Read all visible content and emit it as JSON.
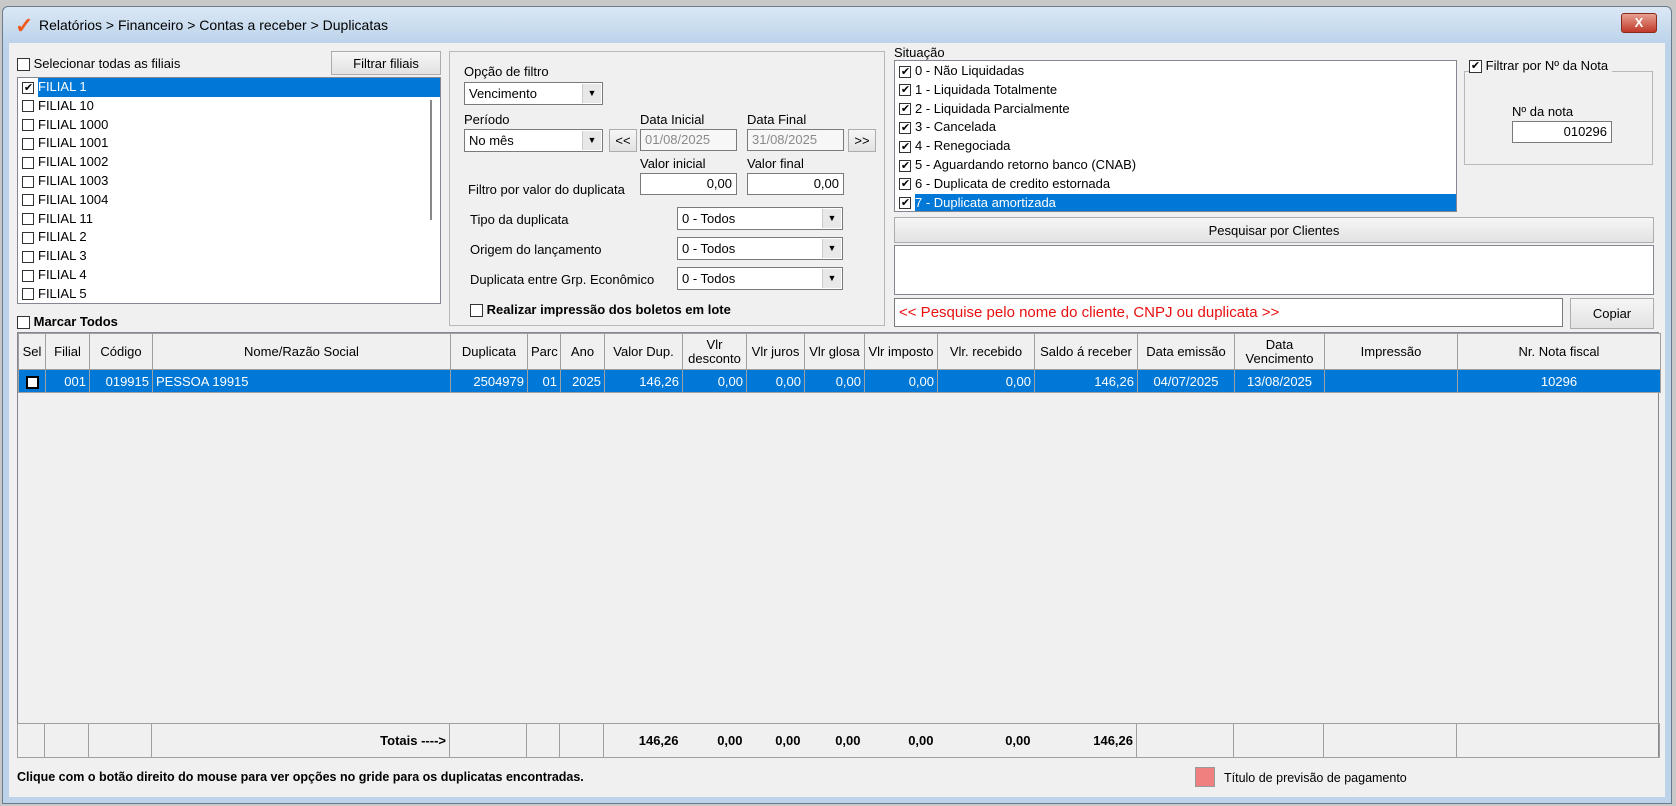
{
  "window": {
    "title": "Relatórios > Financeiro > Contas a receber > Duplicatas",
    "close_label": "X"
  },
  "filiais": {
    "select_all_label": "Selecionar todas as filiais",
    "filter_button": "Filtrar filiais",
    "items": [
      {
        "label": "FILIAL 1",
        "checked": true,
        "selected": true
      },
      {
        "label": "FILIAL 10"
      },
      {
        "label": "FILIAL 1000"
      },
      {
        "label": "FILIAL 1001"
      },
      {
        "label": "FILIAL 1002"
      },
      {
        "label": "FILIAL 1003"
      },
      {
        "label": "FILIAL 1004"
      },
      {
        "label": "FILIAL 11"
      },
      {
        "label": "FILIAL 2"
      },
      {
        "label": "FILIAL 3"
      },
      {
        "label": "FILIAL 4"
      },
      {
        "label": "FILIAL 5"
      }
    ],
    "mark_all_label": "Marcar Todos"
  },
  "filtro": {
    "opcao_label": "Opção de filtro",
    "opcao_value": "Vencimento",
    "periodo_label": "Período",
    "periodo_value": "No mês",
    "prev_label": "<<",
    "next_label": ">>",
    "data_inicial_label": "Data Inicial",
    "data_inicial": "01/08/2025",
    "data_final_label": "Data Final",
    "data_final": "31/08/2025",
    "valor_inicial_label": "Valor inicial",
    "valor_inicial": "0,00",
    "valor_final_label": "Valor final",
    "valor_final": "0,00",
    "filtro_valor_label": "Filtro por valor do duplicata",
    "tipo_label": "Tipo da duplicata",
    "tipo_value": "0 - Todos",
    "origem_label": "Origem do lançamento",
    "origem_value": "0 - Todos",
    "grp_label": "Duplicata entre Grp. Econômico",
    "grp_value": "0 - Todos",
    "lote_label": "Realizar impressão dos boletos em lote"
  },
  "situacao": {
    "label": "Situação",
    "items": [
      "0 - Não Liquidadas",
      "1 - Liquidada Totalmente",
      "2 - Liquidada Parcialmente",
      "3 - Cancelada",
      "4 - Renegociada",
      "5 - Aguardando retorno banco (CNAB)",
      "6 - Duplicata de credito estornada",
      "7 - Duplicata amortizada"
    ],
    "selected_index": 7
  },
  "nota": {
    "filter_label": "Filtrar por Nº da Nota",
    "filter_checked": true,
    "label": "Nº da nota",
    "value": "010296"
  },
  "clientes": {
    "button": "Pesquisar por Clientes",
    "search_placeholder": "<< Pesquise pelo nome do cliente, CNPJ ou duplicata >>",
    "copy_button": "Copiar"
  },
  "grid": {
    "columns": [
      "Sel",
      "Filial",
      "Código",
      "Nome/Razão Social",
      "Duplicata",
      "Parc",
      "Ano",
      "Valor Dup.",
      "Vlr desconto",
      "Vlr juros",
      "Vlr glosa",
      "Vlr imposto",
      "Vlr. recebido",
      "Saldo á receber",
      "Data emissão",
      "Data Vencimento",
      "Impressão",
      "Nr. Nota fiscal"
    ],
    "rows": [
      [
        "",
        "001",
        "019915",
        "PESSOA 19915",
        "2504979",
        "01",
        "2025",
        "146,26",
        "0,00",
        "0,00",
        "0,00",
        "0,00",
        "0,00",
        "146,26",
        "04/07/2025",
        "13/08/2025",
        "",
        "10296"
      ]
    ],
    "totals_label": "Totais ---->",
    "totals": [
      "146,26",
      "0,00",
      "0,00",
      "0,00",
      "0,00",
      "0,00",
      "146,26"
    ]
  },
  "status": {
    "hint": "Clique com o botão direito do mouse para ver opções no gride para os duplicatas encontradas.",
    "legend_label": "Título de previsão de pagamento",
    "legend_color": "#f08080"
  }
}
